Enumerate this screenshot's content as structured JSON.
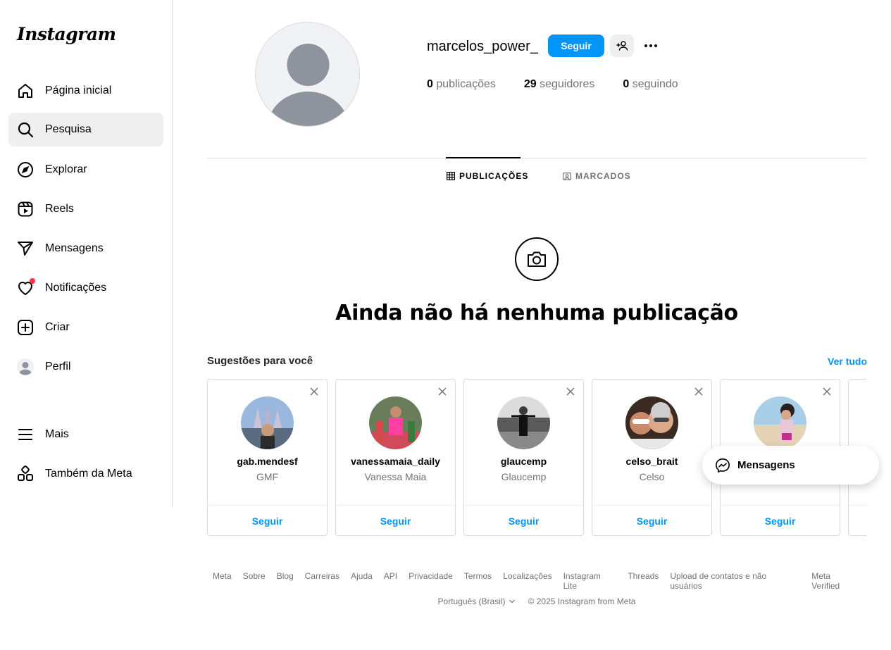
{
  "logo": "Instagram",
  "sidebar": {
    "items": [
      {
        "label": "Página inicial",
        "icon": "home-icon"
      },
      {
        "label": "Pesquisa",
        "icon": "search-icon"
      },
      {
        "label": "Explorar",
        "icon": "compass-icon"
      },
      {
        "label": "Reels",
        "icon": "reels-icon"
      },
      {
        "label": "Mensagens",
        "icon": "send-icon"
      },
      {
        "label": "Notificações",
        "icon": "heart-icon"
      },
      {
        "label": "Criar",
        "icon": "plus-square-icon"
      },
      {
        "label": "Perfil",
        "icon": "avatar"
      },
      {
        "label": "Mais",
        "icon": "menu-icon"
      },
      {
        "label": "Também da Meta",
        "icon": "meta-apps-icon"
      }
    ]
  },
  "profile": {
    "username": "marcelos_power_",
    "follow_label": "Seguir",
    "posts_count": "0",
    "posts_label": "publicações",
    "followers_count": "29",
    "followers_label": "seguidores",
    "following_count": "0",
    "following_label": "seguindo"
  },
  "tabs": {
    "posts": "PUBLICAÇÕES",
    "tagged": "MARCADOS"
  },
  "empty_state": {
    "title": "Ainda não há nenhuma publicação"
  },
  "suggestions": {
    "title": "Sugestões para você",
    "see_all": "Ver tudo",
    "cards": [
      {
        "username": "gab.mendesf",
        "name": "GMF",
        "follow": "Seguir"
      },
      {
        "username": "vanessamaia_daily",
        "name": "Vanessa Maia",
        "follow": "Seguir"
      },
      {
        "username": "glaucemp",
        "name": "Glaucemp",
        "follow": "Seguir"
      },
      {
        "username": "celso_brait",
        "name": "Celso",
        "follow": "Seguir"
      },
      {
        "username": "",
        "name": "",
        "follow": "Seguir"
      }
    ]
  },
  "messages_pill": "Mensagens",
  "footer": {
    "links": [
      "Meta",
      "Sobre",
      "Blog",
      "Carreiras",
      "Ajuda",
      "API",
      "Privacidade",
      "Termos",
      "Localizações",
      "Instagram Lite",
      "Threads",
      "Upload de contatos e não usuários",
      "Meta Verified"
    ],
    "language": "Português (Brasil)",
    "copyright": "© 2025 Instagram from Meta"
  },
  "colors": {
    "accent": "#0095f6",
    "notification": "#ff3040",
    "muted": "#737373"
  }
}
